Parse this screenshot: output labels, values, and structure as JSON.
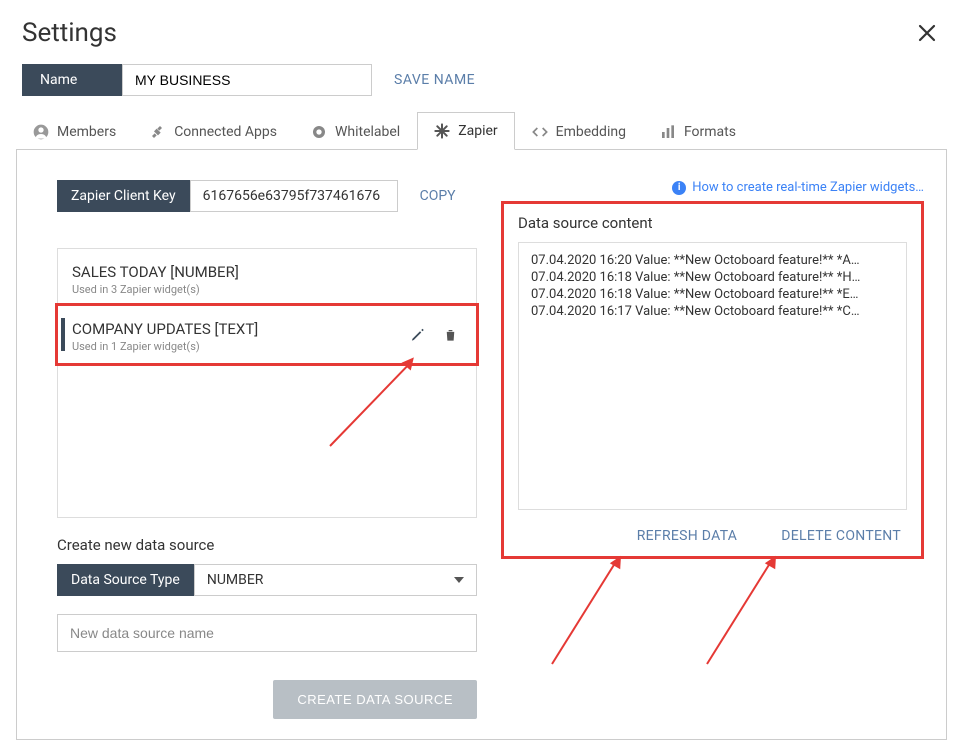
{
  "header": {
    "title": "Settings"
  },
  "nameRow": {
    "label": "Name",
    "value": "MY BUSINESS",
    "saveLabel": "SAVE NAME"
  },
  "tabs": [
    {
      "id": "members",
      "label": "Members",
      "icon": "person-icon"
    },
    {
      "id": "connected-apps",
      "label": "Connected Apps",
      "icon": "plug-icon"
    },
    {
      "id": "whitelabel",
      "label": "Whitelabel",
      "icon": "badge-icon"
    },
    {
      "id": "zapier",
      "label": "Zapier",
      "icon": "asterisk-icon"
    },
    {
      "id": "embedding",
      "label": "Embedding",
      "icon": "code-icon"
    },
    {
      "id": "formats",
      "label": "Formats",
      "icon": "bars-icon"
    }
  ],
  "activeTab": "zapier",
  "zapier": {
    "keyLabel": "Zapier Client Key",
    "keyValue": "6167656e63795f737461676",
    "copyLabel": "COPY",
    "helpLink": "How to create real-time Zapier widgets…"
  },
  "dataSources": [
    {
      "title": "SALES TODAY [NUMBER]",
      "sub": "Used in 3 Zapier widget(s)"
    },
    {
      "title": "COMPANY UPDATES [TEXT]",
      "sub": "Used in 1 Zapier widget(s)"
    }
  ],
  "create": {
    "heading": "Create new data source",
    "typeLabel": "Data Source Type",
    "typeValue": "NUMBER",
    "placeholder": "New data source name",
    "button": "CREATE DATA SOURCE"
  },
  "rightPanel": {
    "title": "Data source content",
    "rows": [
      "07.04.2020 16:20 Value: **New Octoboard feature!** *A…",
      "07.04.2020 16:18 Value: **New Octoboard feature!** *H…",
      "07.04.2020 16:18 Value: **New Octoboard feature!** *E…",
      "07.04.2020 16:17 Value: **New Octoboard feature!** *C…"
    ],
    "refresh": "REFRESH DATA",
    "delete": "DELETE CONTENT"
  }
}
